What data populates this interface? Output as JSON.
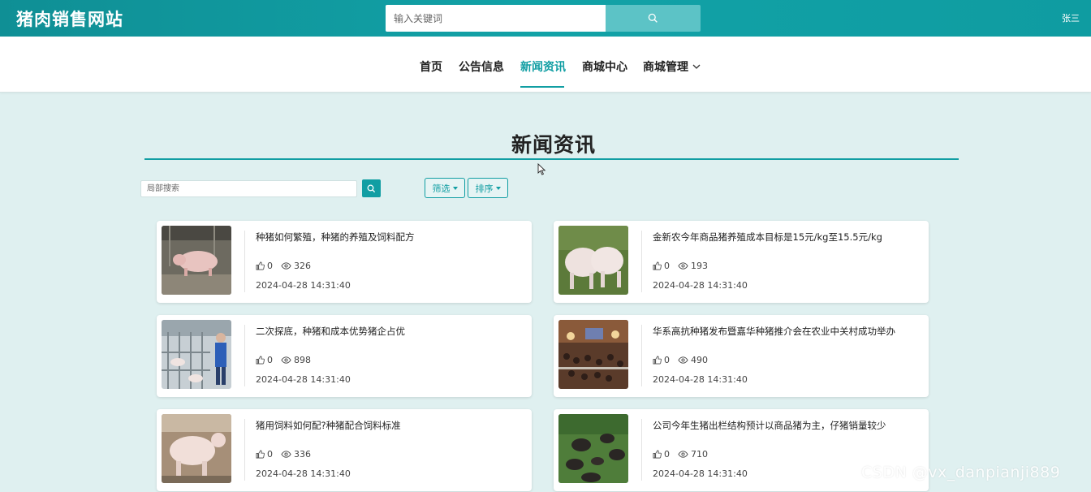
{
  "header": {
    "site_title": "猪肉销售网站",
    "search_placeholder": "输入关键词",
    "user_name": "张三"
  },
  "nav": {
    "items": [
      {
        "label": "首页"
      },
      {
        "label": "公告信息"
      },
      {
        "label": "新闻资讯"
      },
      {
        "label": "商城中心"
      },
      {
        "label": "商城管理"
      }
    ],
    "active_index": 2
  },
  "page": {
    "title": "新闻资讯",
    "local_search_placeholder": "局部搜索",
    "filter_label": "筛选",
    "sort_label": "排序"
  },
  "colors": {
    "accent": "#119ea3",
    "background": "#dff0f0"
  },
  "news": [
    {
      "title": "种猪如何繁殖，种猪的养殖及饲料配方",
      "likes": "0",
      "views": "326",
      "date": "2024-04-28 14:31:40"
    },
    {
      "title": "金新农今年商品猪养殖成本目标是15元/kg至15.5元/kg",
      "likes": "0",
      "views": "193",
      "date": "2024-04-28 14:31:40"
    },
    {
      "title": "二次探底，种猪和成本优势猪企占优",
      "likes": "0",
      "views": "898",
      "date": "2024-04-28 14:31:40"
    },
    {
      "title": "华系高抗种猪发布暨嘉华种猪推介会在农业中关村成功举办",
      "likes": "0",
      "views": "490",
      "date": "2024-04-28 14:31:40"
    },
    {
      "title": "猪用饲料如何配?种猪配合饲料标准",
      "likes": "0",
      "views": "336",
      "date": "2024-04-28 14:31:40"
    },
    {
      "title": "公司今年生猪出栏结构预计以商品猪为主，仔猪销量较少",
      "likes": "0",
      "views": "710",
      "date": "2024-04-28 14:31:40"
    }
  ],
  "watermark": "CSDN @vx_danpianji889"
}
